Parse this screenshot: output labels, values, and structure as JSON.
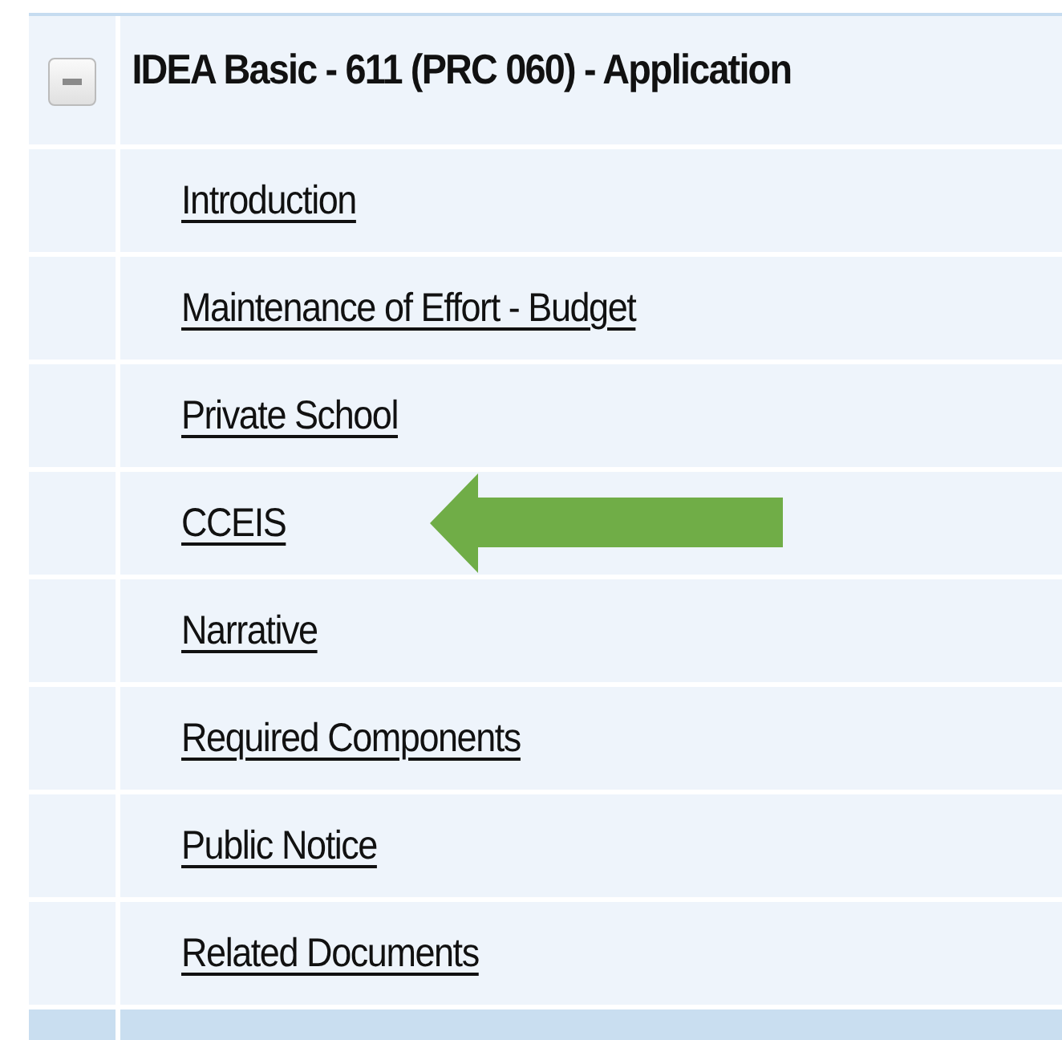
{
  "section": {
    "title": "IDEA Basic - 611 (PRC 060) - Application",
    "expanded": true
  },
  "items": [
    {
      "label": "Introduction",
      "arrow": false
    },
    {
      "label": "Maintenance of Effort - Budget",
      "arrow": false
    },
    {
      "label": "Private School",
      "arrow": false
    },
    {
      "label": "CCEIS",
      "arrow": true
    },
    {
      "label": "Narrative",
      "arrow": false
    },
    {
      "label": "Required Components",
      "arrow": false
    },
    {
      "label": "Public Notice",
      "arrow": false
    },
    {
      "label": "Related Documents",
      "arrow": false
    }
  ]
}
